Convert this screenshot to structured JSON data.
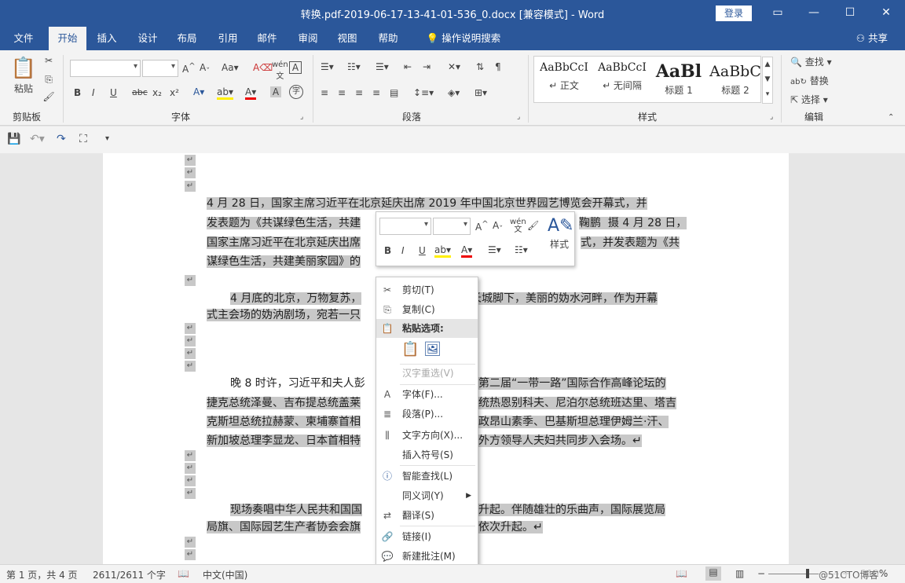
{
  "window": {
    "title": "转换.pdf-2019-06-17-13-41-01-536_0.docx [兼容模式]  -  Word",
    "login": "登录"
  },
  "tabs": [
    "文件",
    "开始",
    "插入",
    "设计",
    "布局",
    "引用",
    "邮件",
    "审阅",
    "视图",
    "帮助"
  ],
  "tell_me": "操作说明搜索",
  "share": "共享",
  "ribbon": {
    "groups": {
      "clipboard": "剪贴板",
      "font": "字体",
      "paragraph": "段落",
      "styles": "样式",
      "editing": "编辑"
    },
    "paste_label": "粘贴",
    "font_buttons": [
      "B",
      "I",
      "U",
      "abc",
      "x₂",
      "x²"
    ],
    "styles": [
      {
        "sample": "AaBbCcI",
        "name": "↵ 正文"
      },
      {
        "sample": "AaBbCcI",
        "name": "↵ 无间隔"
      },
      {
        "sample": "AaBl",
        "name": "标题 1"
      },
      {
        "sample": "AaBbC",
        "name": "标题 2"
      }
    ],
    "editing": [
      "查找",
      "替换",
      "选择"
    ]
  },
  "document": {
    "paragraphs": [
      [
        "4 月 28 日，国家主席习近平在北京延庆出席 2019 年中国北京世界园艺博览会开幕式，并",
        "发表题为《共谋绿色生活，共建",
        "鞠鹏  摄 4 月 28 日，",
        "国家主席习近平在北京延庆出席",
        "式，并发表题为《共",
        "谋绿色生活，共建美丽家园》的"
      ],
      [
        "4 月底的北京，万物复苏，",
        "长城脚下，美丽的妫水河畔，作为开幕",
        "式主会场的妫汭剧场，宛若一只"
      ],
      [
        "晚 8 时许，习近平和夫人彭",
        "第二届“一带一路”国际合作高峰论坛的",
        "捷克总统泽曼、吉布提总统盖莱",
        "统热恩别科夫、尼泊尔总统班达里、塔吉",
        "克斯坦总统拉赫蒙、柬埔寨首相",
        "政昂山素季、巴基斯坦总理伊姆兰·汗、",
        "新加坡总理李显龙、日本首相特",
        "外方领导人夫妇共同步入会场。↵"
      ],
      [
        "现场奏唱中华人民共和国国",
        "升起。伴随雄壮的乐曲声，国际展览局",
        "局旗、国际园艺生产者协会会旗",
        "依次升起。↵"
      ]
    ]
  },
  "mini_toolbar": {
    "styles_label": "样式",
    "buttons": [
      "B",
      "I",
      "U"
    ]
  },
  "context_menu": {
    "items": [
      "剪切(T)",
      "复制(C)",
      "粘贴选项:",
      "汉字重选(V)",
      "字体(F)...",
      "段落(P)...",
      "文字方向(X)...",
      "插入符号(S)",
      "智能查找(L)",
      "同义词(Y)",
      "翻译(S)",
      "链接(I)",
      "新建批注(M)"
    ]
  },
  "status": {
    "page": "第 1 页，共 4 页",
    "words": "2611/2611 个字",
    "language": "中文(中国)",
    "zoom": "110%",
    "watermark": "@51CTO博客"
  }
}
